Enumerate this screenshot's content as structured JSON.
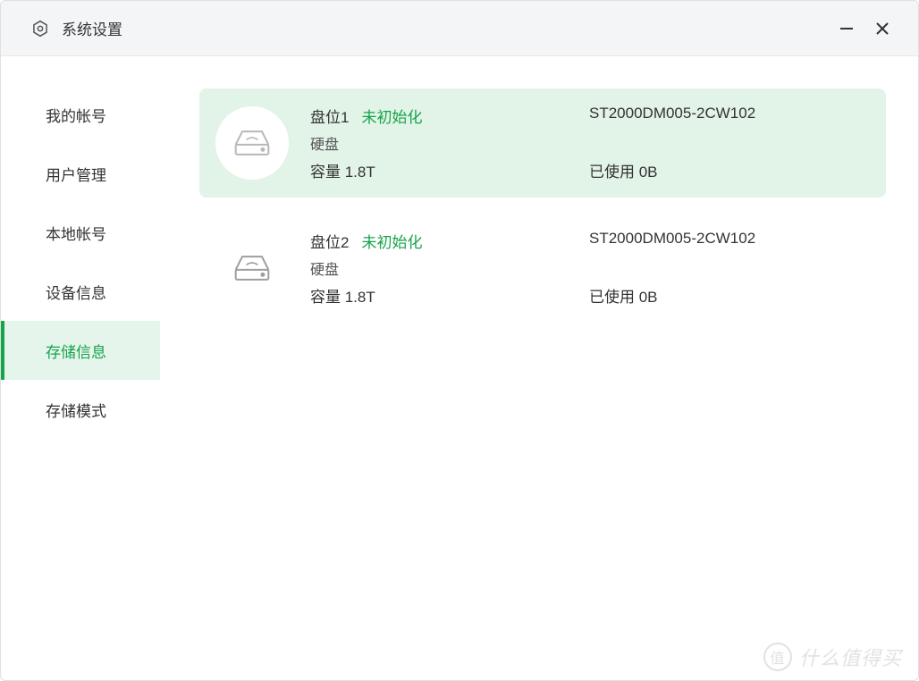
{
  "window": {
    "title": "系统设置"
  },
  "sidebar": {
    "items": [
      {
        "label": "我的帐号"
      },
      {
        "label": "用户管理"
      },
      {
        "label": "本地帐号"
      },
      {
        "label": "设备信息"
      },
      {
        "label": "存储信息"
      },
      {
        "label": "存储模式"
      }
    ],
    "active_index": 4
  },
  "drives": [
    {
      "slot_label": "盘位1",
      "status": "未初始化",
      "model": "ST2000DM005-2CW102",
      "type_label": "硬盘",
      "capacity_label": "容量 1.8T",
      "used_label": "已使用 0B",
      "selected": true
    },
    {
      "slot_label": "盘位2",
      "status": "未初始化",
      "model": "ST2000DM005-2CW102",
      "type_label": "硬盘",
      "capacity_label": "容量 1.8T",
      "used_label": "已使用 0B",
      "selected": false
    }
  ],
  "watermark": {
    "badge": "值",
    "text": "什么值得买"
  }
}
